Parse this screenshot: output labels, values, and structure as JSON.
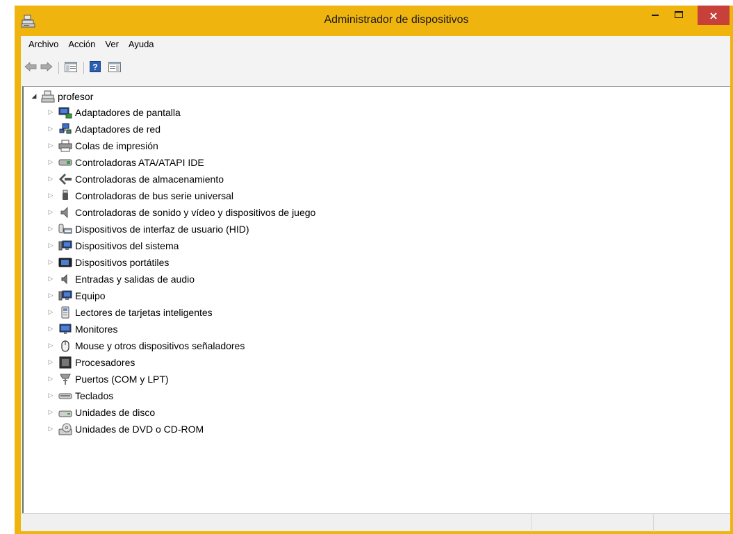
{
  "window": {
    "title": "Administrador de dispositivos",
    "accent_color": "#f0b40e",
    "close_color": "#c7413a",
    "close_glyph": "×",
    "icons": [
      "computer-icon",
      "minimize-icon",
      "maximize-icon",
      "close-icon"
    ]
  },
  "menu": {
    "items": [
      "Archivo",
      "Acción",
      "Ver",
      "Ayuda"
    ]
  },
  "toolbar": {
    "buttons": [
      "back-arrow-icon",
      "forward-arrow-icon",
      "show-hide-console-tree-icon",
      "help-icon",
      "action-pane-icon"
    ]
  },
  "tree": {
    "root_label": "profesor",
    "root_icon": "computer-icon",
    "items": [
      {
        "label": "Adaptadores de pantalla",
        "icon": "display-adapter-icon"
      },
      {
        "label": "Adaptadores de red",
        "icon": "network-adapter-icon"
      },
      {
        "label": "Colas de impresión",
        "icon": "printer-icon"
      },
      {
        "label": "Controladoras ATA/ATAPI IDE",
        "icon": "ide-controller-icon"
      },
      {
        "label": "Controladoras de almacenamiento",
        "icon": "storage-controller-icon"
      },
      {
        "label": "Controladoras de bus serie universal",
        "icon": "usb-icon"
      },
      {
        "label": "Controladoras de sonido y vídeo y dispositivos de juego",
        "icon": "speaker-icon"
      },
      {
        "label": "Dispositivos de interfaz de usuario (HID)",
        "icon": "hid-icon"
      },
      {
        "label": "Dispositivos del sistema",
        "icon": "system-device-icon"
      },
      {
        "label": "Dispositivos portátiles",
        "icon": "portable-device-icon"
      },
      {
        "label": "Entradas y salidas de audio",
        "icon": "audio-icon"
      },
      {
        "label": "Equipo",
        "icon": "computer-system-icon"
      },
      {
        "label": "Lectores de tarjetas inteligentes",
        "icon": "smart-card-icon"
      },
      {
        "label": "Monitores",
        "icon": "monitor-icon"
      },
      {
        "label": "Mouse y otros dispositivos señaladores",
        "icon": "mouse-icon"
      },
      {
        "label": "Procesadores",
        "icon": "processor-icon"
      },
      {
        "label": "Puertos (COM y LPT)",
        "icon": "port-icon"
      },
      {
        "label": "Teclados",
        "icon": "keyboard-icon"
      },
      {
        "label": "Unidades de disco",
        "icon": "disk-drive-icon"
      },
      {
        "label": "Unidades de DVD o CD-ROM",
        "icon": "dvd-drive-icon"
      }
    ]
  }
}
